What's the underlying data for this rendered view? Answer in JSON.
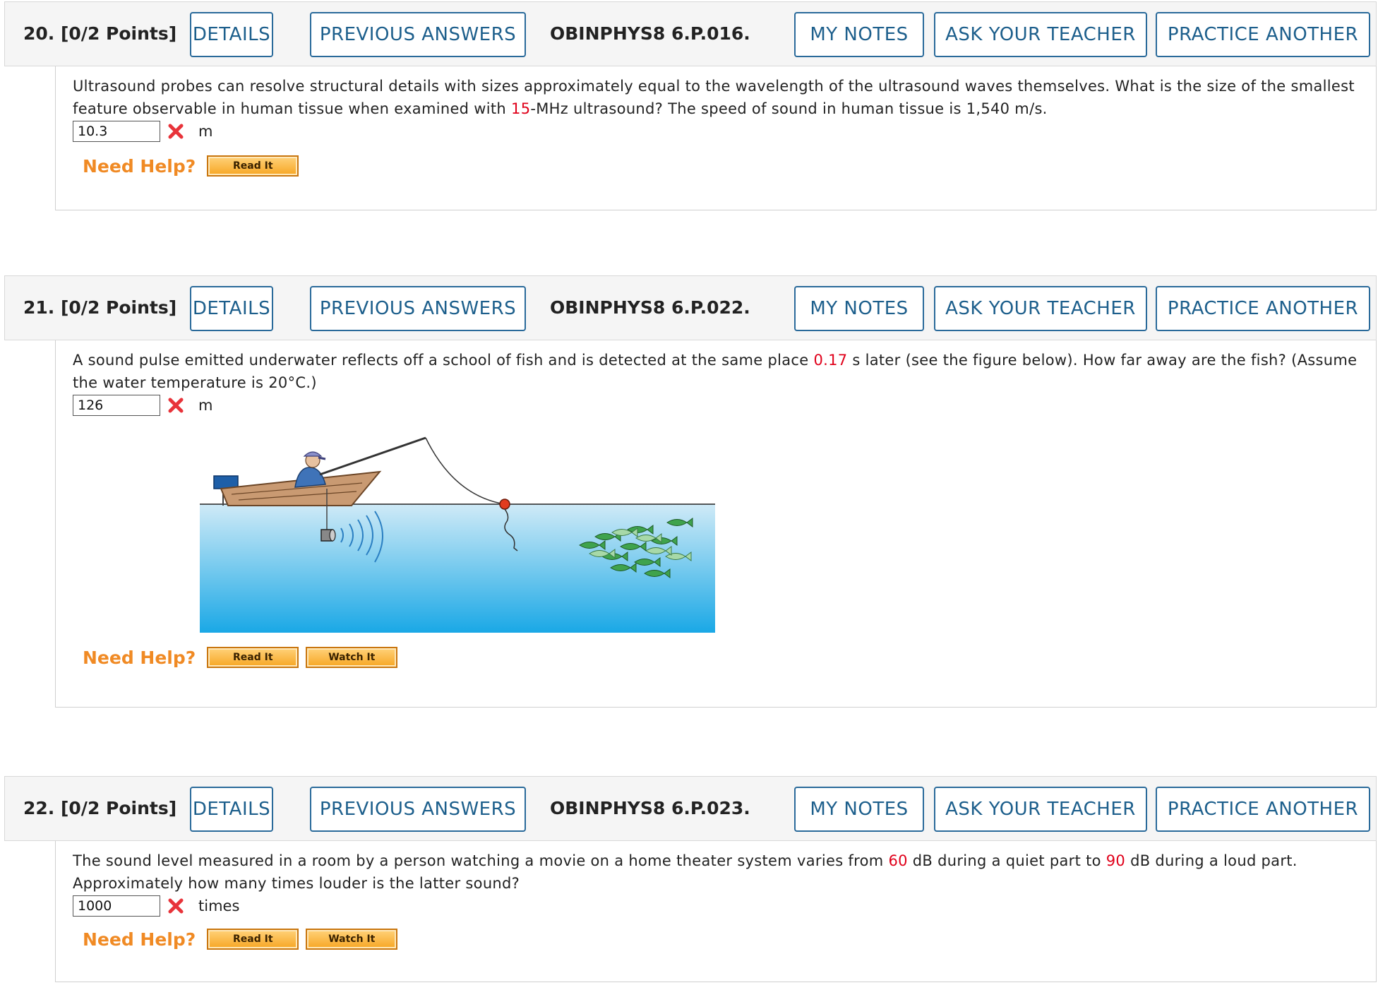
{
  "header_buttons": {
    "details": "DETAILS",
    "previous_answers": "PREVIOUS ANSWERS",
    "my_notes": "MY NOTES",
    "ask_teacher": "ASK YOUR TEACHER",
    "practice_another": "PRACTICE ANOTHER"
  },
  "help": {
    "need_help": "Need Help?",
    "read_it": "Read It",
    "watch_it": "Watch It"
  },
  "questions": [
    {
      "number": "20.  [0/2 Points]",
      "code": "OBINPHYS8 6.P.016.",
      "text_1": "Ultrasound probes can resolve structural details with sizes approximately equal to the wavelength of the ultrasound waves themselves. What is the size of the smallest feature observable in human tissue when examined with ",
      "highlight_1": "15",
      "text_2": "-MHz ultrasound? The speed of sound in human tissue is 1,540 m/s.",
      "answer": "10.3",
      "unit": "m"
    },
    {
      "number": "21.  [0/2 Points]",
      "code": "OBINPHYS8 6.P.022.",
      "text_1": "A sound pulse emitted underwater reflects off a school of fish and is detected at the same place ",
      "highlight_1": "0.17",
      "text_2": " s later (see the figure below). How far away are the fish? (Assume the water temperature is 20°C.)",
      "answer": "126",
      "unit": "m"
    },
    {
      "number": "22.  [0/2 Points]",
      "code": "OBINPHYS8 6.P.023.",
      "text_1": "The sound level measured in a room by a person watching a movie on a home theater system varies from ",
      "highlight_1": "60",
      "text_2": " dB during a quiet part to ",
      "highlight_2": "90",
      "text_3": " dB during a loud part. Approximately how many times louder is the latter sound?",
      "answer": "1000",
      "unit": "times"
    }
  ],
  "colors": {
    "button_border": "#2a6a9a",
    "button_text": "#1d5f8c",
    "highlight": "#e0001a",
    "need_help": "#f08a24",
    "incorrect": "#e8333a"
  },
  "icons": {
    "incorrect": "x-mark-icon"
  }
}
